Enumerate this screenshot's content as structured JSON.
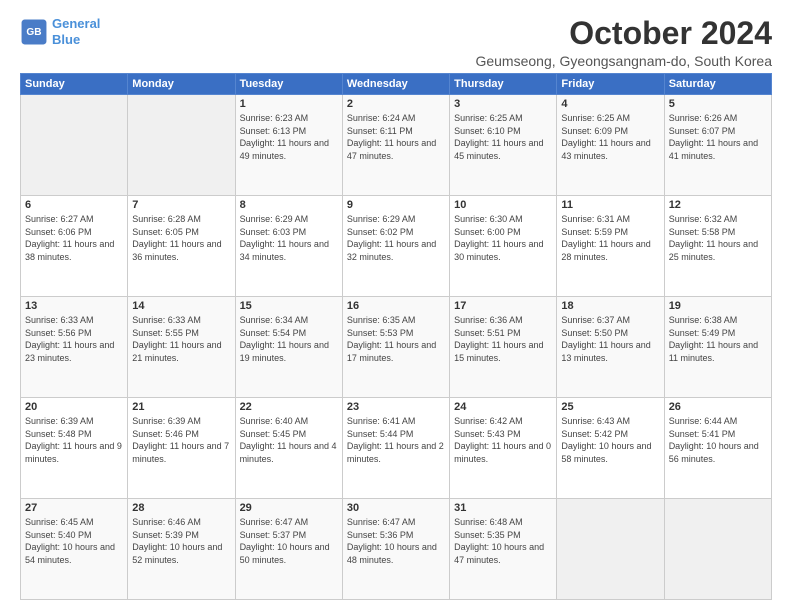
{
  "logo": {
    "line1": "General",
    "line2": "Blue"
  },
  "title": "October 2024",
  "subtitle": "Geumseong, Gyeongsangnam-do, South Korea",
  "days_of_week": [
    "Sunday",
    "Monday",
    "Tuesday",
    "Wednesday",
    "Thursday",
    "Friday",
    "Saturday"
  ],
  "weeks": [
    [
      {
        "day": "",
        "info": ""
      },
      {
        "day": "",
        "info": ""
      },
      {
        "day": "1",
        "info": "Sunrise: 6:23 AM\nSunset: 6:13 PM\nDaylight: 11 hours and 49 minutes."
      },
      {
        "day": "2",
        "info": "Sunrise: 6:24 AM\nSunset: 6:11 PM\nDaylight: 11 hours and 47 minutes."
      },
      {
        "day": "3",
        "info": "Sunrise: 6:25 AM\nSunset: 6:10 PM\nDaylight: 11 hours and 45 minutes."
      },
      {
        "day": "4",
        "info": "Sunrise: 6:25 AM\nSunset: 6:09 PM\nDaylight: 11 hours and 43 minutes."
      },
      {
        "day": "5",
        "info": "Sunrise: 6:26 AM\nSunset: 6:07 PM\nDaylight: 11 hours and 41 minutes."
      }
    ],
    [
      {
        "day": "6",
        "info": "Sunrise: 6:27 AM\nSunset: 6:06 PM\nDaylight: 11 hours and 38 minutes."
      },
      {
        "day": "7",
        "info": "Sunrise: 6:28 AM\nSunset: 6:05 PM\nDaylight: 11 hours and 36 minutes."
      },
      {
        "day": "8",
        "info": "Sunrise: 6:29 AM\nSunset: 6:03 PM\nDaylight: 11 hours and 34 minutes."
      },
      {
        "day": "9",
        "info": "Sunrise: 6:29 AM\nSunset: 6:02 PM\nDaylight: 11 hours and 32 minutes."
      },
      {
        "day": "10",
        "info": "Sunrise: 6:30 AM\nSunset: 6:00 PM\nDaylight: 11 hours and 30 minutes."
      },
      {
        "day": "11",
        "info": "Sunrise: 6:31 AM\nSunset: 5:59 PM\nDaylight: 11 hours and 28 minutes."
      },
      {
        "day": "12",
        "info": "Sunrise: 6:32 AM\nSunset: 5:58 PM\nDaylight: 11 hours and 25 minutes."
      }
    ],
    [
      {
        "day": "13",
        "info": "Sunrise: 6:33 AM\nSunset: 5:56 PM\nDaylight: 11 hours and 23 minutes."
      },
      {
        "day": "14",
        "info": "Sunrise: 6:33 AM\nSunset: 5:55 PM\nDaylight: 11 hours and 21 minutes."
      },
      {
        "day": "15",
        "info": "Sunrise: 6:34 AM\nSunset: 5:54 PM\nDaylight: 11 hours and 19 minutes."
      },
      {
        "day": "16",
        "info": "Sunrise: 6:35 AM\nSunset: 5:53 PM\nDaylight: 11 hours and 17 minutes."
      },
      {
        "day": "17",
        "info": "Sunrise: 6:36 AM\nSunset: 5:51 PM\nDaylight: 11 hours and 15 minutes."
      },
      {
        "day": "18",
        "info": "Sunrise: 6:37 AM\nSunset: 5:50 PM\nDaylight: 11 hours and 13 minutes."
      },
      {
        "day": "19",
        "info": "Sunrise: 6:38 AM\nSunset: 5:49 PM\nDaylight: 11 hours and 11 minutes."
      }
    ],
    [
      {
        "day": "20",
        "info": "Sunrise: 6:39 AM\nSunset: 5:48 PM\nDaylight: 11 hours and 9 minutes."
      },
      {
        "day": "21",
        "info": "Sunrise: 6:39 AM\nSunset: 5:46 PM\nDaylight: 11 hours and 7 minutes."
      },
      {
        "day": "22",
        "info": "Sunrise: 6:40 AM\nSunset: 5:45 PM\nDaylight: 11 hours and 4 minutes."
      },
      {
        "day": "23",
        "info": "Sunrise: 6:41 AM\nSunset: 5:44 PM\nDaylight: 11 hours and 2 minutes."
      },
      {
        "day": "24",
        "info": "Sunrise: 6:42 AM\nSunset: 5:43 PM\nDaylight: 11 hours and 0 minutes."
      },
      {
        "day": "25",
        "info": "Sunrise: 6:43 AM\nSunset: 5:42 PM\nDaylight: 10 hours and 58 minutes."
      },
      {
        "day": "26",
        "info": "Sunrise: 6:44 AM\nSunset: 5:41 PM\nDaylight: 10 hours and 56 minutes."
      }
    ],
    [
      {
        "day": "27",
        "info": "Sunrise: 6:45 AM\nSunset: 5:40 PM\nDaylight: 10 hours and 54 minutes."
      },
      {
        "day": "28",
        "info": "Sunrise: 6:46 AM\nSunset: 5:39 PM\nDaylight: 10 hours and 52 minutes."
      },
      {
        "day": "29",
        "info": "Sunrise: 6:47 AM\nSunset: 5:37 PM\nDaylight: 10 hours and 50 minutes."
      },
      {
        "day": "30",
        "info": "Sunrise: 6:47 AM\nSunset: 5:36 PM\nDaylight: 10 hours and 48 minutes."
      },
      {
        "day": "31",
        "info": "Sunrise: 6:48 AM\nSunset: 5:35 PM\nDaylight: 10 hours and 47 minutes."
      },
      {
        "day": "",
        "info": ""
      },
      {
        "day": "",
        "info": ""
      }
    ]
  ]
}
